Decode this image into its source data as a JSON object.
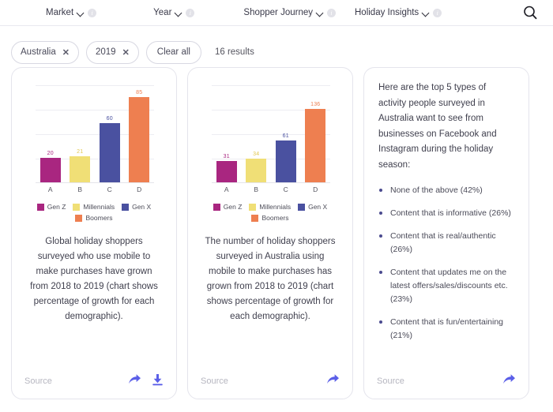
{
  "topnav": {
    "items": [
      {
        "label": "Market",
        "icon": "chevron-down-icon",
        "info": "i"
      },
      {
        "label": "Year",
        "icon": "chevron-down-icon",
        "info": "i"
      },
      {
        "label": "Shopper Journey",
        "icon": "chevron-down-icon",
        "info": "i"
      },
      {
        "label": "Holiday Insights",
        "icon": "chevron-down-icon",
        "info": "i"
      }
    ],
    "search_icon": "search-icon"
  },
  "filterbar": {
    "chips": [
      {
        "label": "Australia",
        "remove": "✕"
      },
      {
        "label": "2019",
        "remove": "✕"
      }
    ],
    "clear_all": "Clear all",
    "results": "16 results"
  },
  "colors": {
    "gen_z": "#a92680",
    "millennials": "#f0df76",
    "gen_x": "#4a51a0",
    "boomers": "#ee7f50",
    "accent": "#5b5fe8",
    "bullet": "#4b4b8f"
  },
  "cards": [
    {
      "caption": "Global holiday shoppers surveyed who use mobile to make purchases have grown from 2018 to 2019 (chart shows percentage of growth for each demographic).",
      "source": "Source",
      "icons": [
        "share-icon",
        "download-icon"
      ]
    },
    {
      "caption": "The number of holiday shoppers surveyed in Australia using mobile to make purchases has grown from 2018 to 2019 (chart shows percentage of growth for each demographic).",
      "source": "Source",
      "icons": [
        "share-icon"
      ]
    },
    {
      "intro": "Here are the top 5 types of activity people surveyed in Australia want to see from businesses on Facebook and Instagram during the holiday season:",
      "bullets": [
        "None of the above (42%)",
        "Content that is informative (26%)",
        "Content that is real/authentic (26%)",
        "Content that updates me on the latest offers/sales/discounts etc. (23%)",
        "Content that is fun/entertaining (21%)"
      ],
      "source": "Source",
      "icons": [
        "share-icon"
      ]
    }
  ],
  "chart_data": [
    {
      "type": "bar",
      "title": "",
      "categories": [
        "A",
        "B",
        "C",
        "D"
      ],
      "values": [
        20,
        21,
        60,
        85
      ],
      "series_names": [
        "Gen Z",
        "Millennials",
        "Gen X",
        "Boomers"
      ],
      "bar_colors": [
        "#a92680",
        "#f0df76",
        "#4a51a0",
        "#ee7f50"
      ],
      "xlabel": "",
      "ylabel": "",
      "ylim": [
        0,
        100
      ],
      "gridlines": 5,
      "legend_position": "bottom",
      "data_labels": true
    },
    {
      "type": "bar",
      "title": "",
      "categories": [
        "A",
        "B",
        "C",
        "D"
      ],
      "values": [
        31,
        34,
        61,
        136
      ],
      "series_names": [
        "Gen Z",
        "Millennials",
        "Gen X",
        "Boomers"
      ],
      "bar_colors": [
        "#a92680",
        "#f0df76",
        "#4a51a0",
        "#ee7f50"
      ],
      "xlabel": "",
      "ylabel": "",
      "ylim": [
        0,
        160
      ],
      "gridlines": 5,
      "legend_position": "bottom",
      "data_labels": true
    }
  ]
}
